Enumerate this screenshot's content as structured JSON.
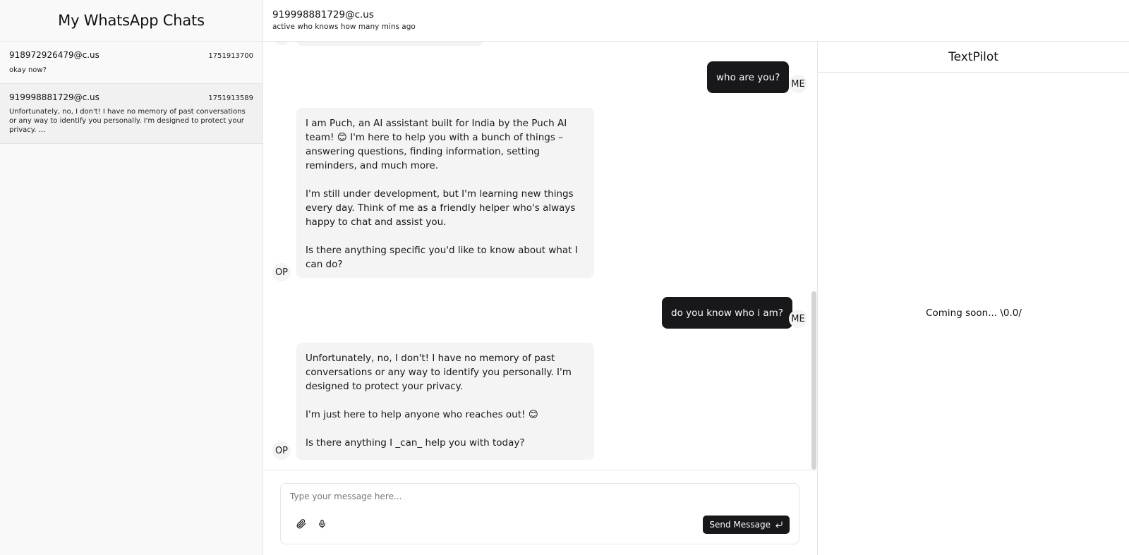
{
  "sidebar": {
    "title": "My WhatsApp Chats",
    "chats": [
      {
        "name": "918972926479@c.us",
        "timestamp": "1751913700",
        "preview": "okay now?"
      },
      {
        "name": "919998881729@c.us",
        "timestamp": "1751913589",
        "preview": "Unfortunately, no, I don't! I have no memory of past conversations or any way to identify you personally. I'm designed to protect your privacy. ..."
      }
    ]
  },
  "chat": {
    "contact": "919998881729@c.us",
    "status": "active who knows how many mins ago",
    "messages": [
      {
        "from": "me",
        "avatar": "ME",
        "text": "who are you?"
      },
      {
        "from": "op",
        "avatar": "OP",
        "paragraphs": [
          "I am Puch, an AI assistant built for India by the Puch AI team! 😊 I'm here to help you with a bunch of things – answering questions, finding information, setting reminders, and much more.",
          "I'm still under development, but I'm learning new things every day. Think of me as a friendly helper who's always happy to chat and assist you.",
          "Is there anything specific you'd like to know about what I can do?"
        ]
      },
      {
        "from": "me",
        "avatar": "ME",
        "text": "do you know who i am?"
      },
      {
        "from": "op",
        "avatar": "OP",
        "paragraphs": [
          "Unfortunately, no, I don't! I have no memory of past conversations or any way to identify you personally. I'm designed to protect your privacy.",
          "I'm just here to help anyone who reaches out! 😊",
          "Is there anything I _can_ help you with today?"
        ]
      }
    ]
  },
  "composer": {
    "placeholder": "Type your message here...",
    "send_label": "Send Message",
    "attach_icon": "paperclip-icon",
    "mic_icon": "microphone-icon",
    "enter_icon": "corner-down-left-icon"
  },
  "pilot": {
    "title": "TextPilot",
    "message": "Coming soon... \\0.0/"
  },
  "colors": {
    "accent_dark": "#18181b",
    "bubble_light": "#f4f4f5",
    "sidebar_bg": "#f9f9f9",
    "active_chat_bg": "#f1f1f1",
    "border": "#e5e5e5"
  }
}
